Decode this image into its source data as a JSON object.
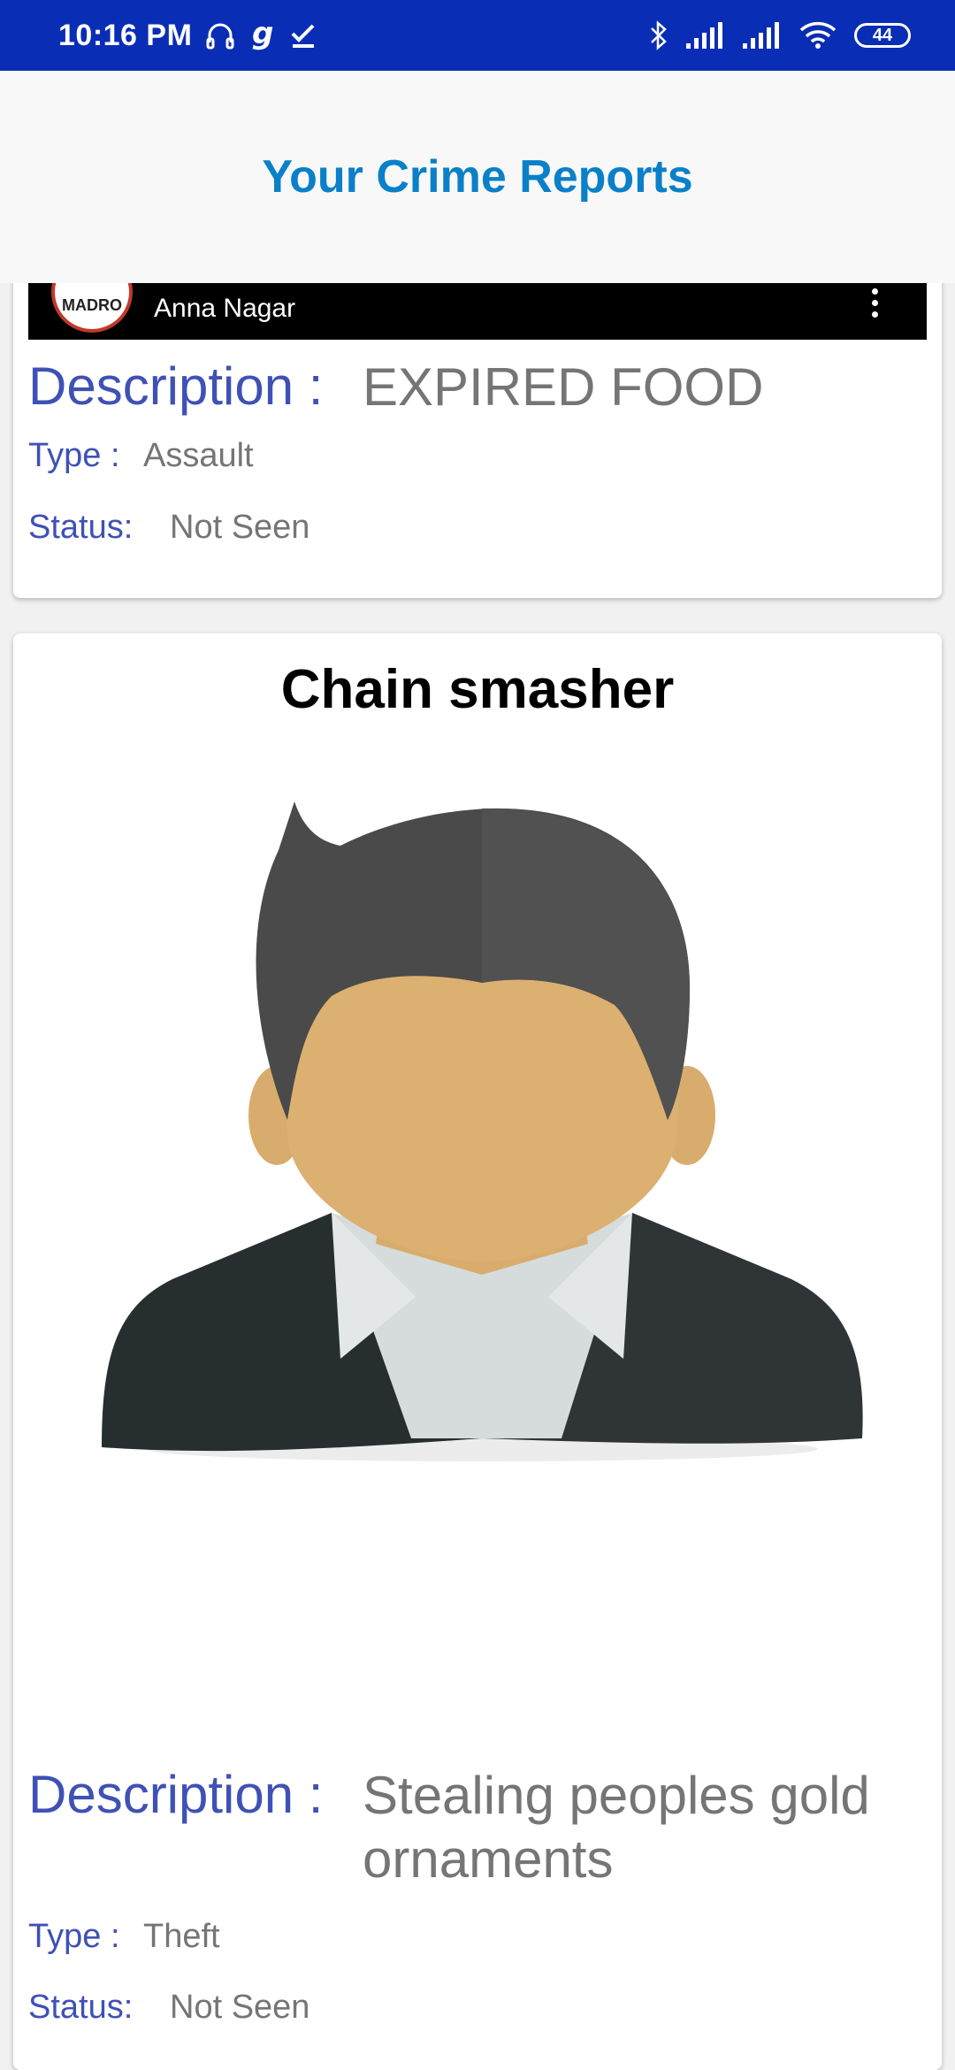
{
  "status_bar": {
    "time": "10:16 PM",
    "battery": "44",
    "icons": [
      "headphones-icon",
      "g-app-icon",
      "check-icon",
      "bluetooth-icon",
      "signal-icon",
      "signal-icon",
      "wifi-icon",
      "battery-icon"
    ]
  },
  "header": {
    "title": "Your Crime Reports"
  },
  "reports": [
    {
      "video_location": "Anna Nagar",
      "logo_text": "MADRO",
      "description_label": "Description :",
      "description": "EXPIRED FOOD",
      "type_label": "Type :",
      "type": "Assault",
      "status_label": "Status:",
      "status": "Not Seen"
    },
    {
      "title": "Chain smasher",
      "image": "person-avatar-icon",
      "description_label": "Description :",
      "description": "Stealing peoples gold ornaments",
      "type_label": "Type :",
      "type": "Theft",
      "status_label": "Status:",
      "status": "Not Seen"
    }
  ],
  "colors": {
    "status_bar": "#0a2db5",
    "title": "#0a80c8",
    "label": "#3f51b5",
    "value": "#757575"
  }
}
